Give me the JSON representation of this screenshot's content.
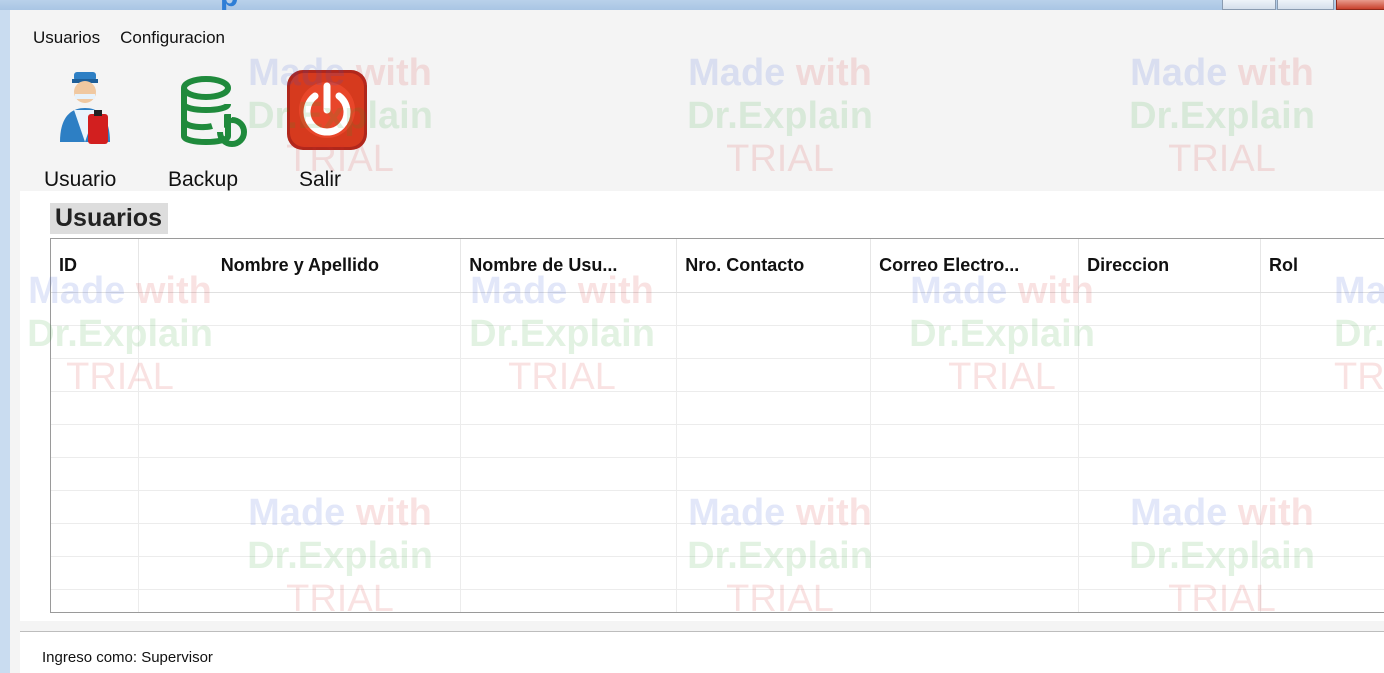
{
  "window": {
    "title_fragment": "p"
  },
  "menu": {
    "items": [
      "Usuarios",
      "Configuracion"
    ]
  },
  "toolbar": {
    "buttons": [
      {
        "label": "Usuario",
        "icon": "user-icon"
      },
      {
        "label": "Backup",
        "icon": "database-backup-icon"
      },
      {
        "label": "Salir",
        "icon": "power-icon"
      }
    ]
  },
  "section": {
    "title": "Usuarios"
  },
  "grid": {
    "columns": [
      "ID",
      "Nombre y Apellido",
      "Nombre de Usu...",
      "Nro. Contacto",
      "Correo Electro...",
      "Direccion",
      "Rol"
    ],
    "rows": []
  },
  "status": {
    "text": "Ingreso como: Supervisor"
  },
  "watermark": {
    "line1a": "Made",
    "line1b": " with",
    "line2": "Dr.Explain",
    "line3": "TRIAL"
  },
  "colors": {
    "accent": "#2e7ed6",
    "exit_red": "#d63a1e",
    "backup_green": "#1f8a3c"
  }
}
